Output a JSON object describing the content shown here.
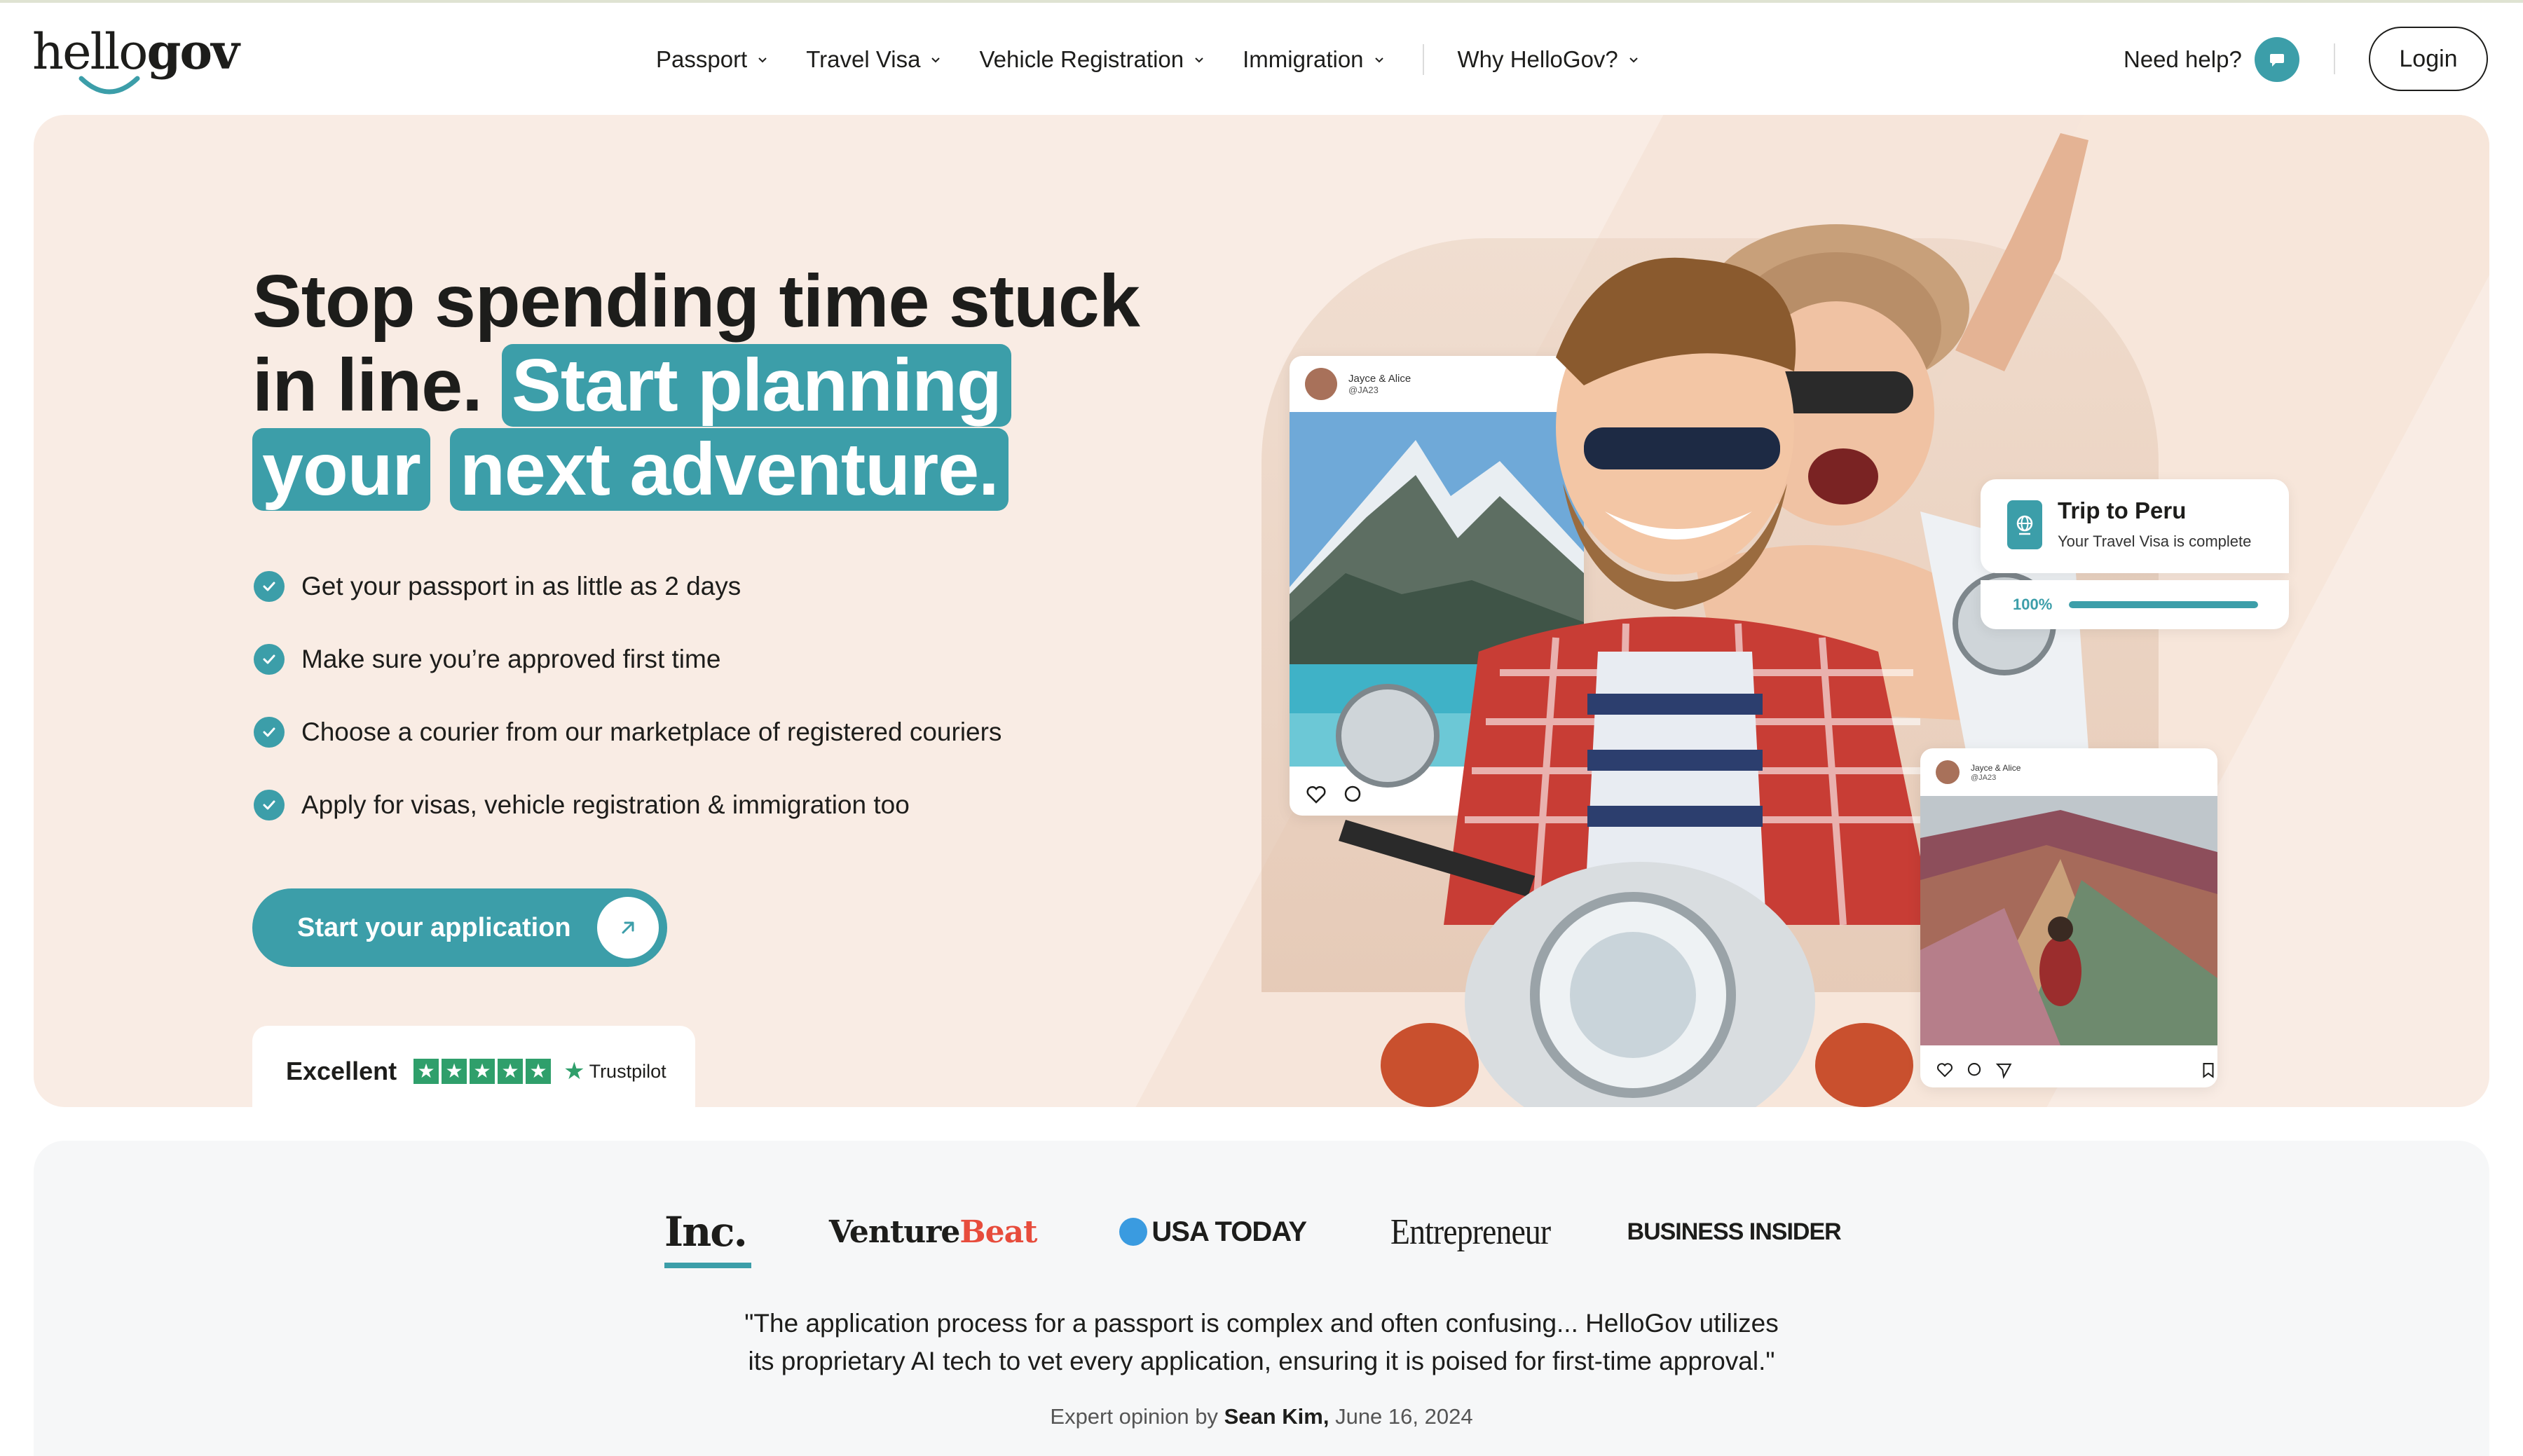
{
  "brand": {
    "name_light": "hello",
    "name_bold": "gov",
    "accent": "#3c9ea9",
    "hero_bg": "#f9ece4"
  },
  "nav": {
    "items": [
      {
        "label": "Passport"
      },
      {
        "label": "Travel Visa"
      },
      {
        "label": "Vehicle Registration"
      },
      {
        "label": "Immigration"
      },
      {
        "label": "Why HelloGov?"
      }
    ],
    "help_label": "Need help?",
    "help_icon": "chat-bubble-icon",
    "login_label": "Login"
  },
  "hero": {
    "headline_plain": "Stop spending time stuck in line.",
    "headline_highlight_1": "Start planning your",
    "headline_highlight_2": "next adventure.",
    "bullets": [
      "Get your passport in as little as 2 days",
      "Make sure you’re approved first time",
      "Choose a courier from our marketplace of registered couriers",
      "Apply for visas, vehicle registration & immigration too"
    ],
    "cta_label": "Start your application",
    "cta_icon": "arrow-up-right-icon",
    "trust_rating": "Excellent",
    "trust_brand": "Trustpilot",
    "trust_stars": 5
  },
  "social_posts": [
    {
      "name": "Jayce & Alice",
      "handle": "@JA23"
    },
    {
      "name": "Jayce & Alice",
      "handle": "@JA23"
    }
  ],
  "trip_card": {
    "title": "Trip to Peru",
    "subtitle": "Your Travel Visa is complete",
    "progress_label": "100%",
    "progress": 1.0,
    "icon": "passport-globe-icon"
  },
  "press": {
    "logos": {
      "inc": "Inc.",
      "venturebeat_a": "Venture",
      "venturebeat_b": "Beat",
      "usatoday": "USA TODAY",
      "entrepreneur": "Entrepreneur",
      "business_insider": "BUSINESS INSIDER"
    },
    "quote_line1": "\"The application process for a passport is complex and often confusing... HelloGov utilizes",
    "quote_line2": "its proprietary AI tech to vet every application, ensuring it is poised for first-time approval.\"",
    "attribution_prefix": "Expert opinion by",
    "attribution_name": "Sean Kim,",
    "attribution_date": "June 16, 2024"
  }
}
